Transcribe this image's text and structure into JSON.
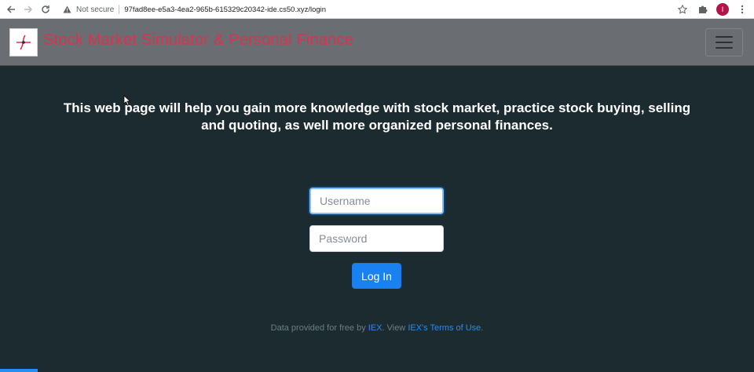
{
  "browser": {
    "back_icon": "arrow-left-icon",
    "forward_icon": "arrow-right-icon",
    "reload_icon": "reload-icon",
    "security_label": "Not secure",
    "url": "97fad8ee-e5a3-4ea2-965b-615329c20342-ide.cs50.xyz/login",
    "profile_initial": "I"
  },
  "navbar": {
    "brand": "Stock Market Simulator & Personal Finance",
    "brand_color": "#d6344f",
    "background_color": "#6a6d72"
  },
  "main": {
    "intro": "This web page will help you gain more knowledge with stock market, practice stock buying, selling and quoting, as well more organized personal finances.",
    "background_color": "#1b2b2f",
    "username_placeholder": "Username",
    "password_placeholder": "Password",
    "login_label": "Log In",
    "button_color": "#1a82f0"
  },
  "footer": {
    "prefix": "Data provided for free by ",
    "iex_link": "IEX",
    "middle": ". View ",
    "terms_link": "IEX's Terms of Use",
    "suffix": "."
  }
}
